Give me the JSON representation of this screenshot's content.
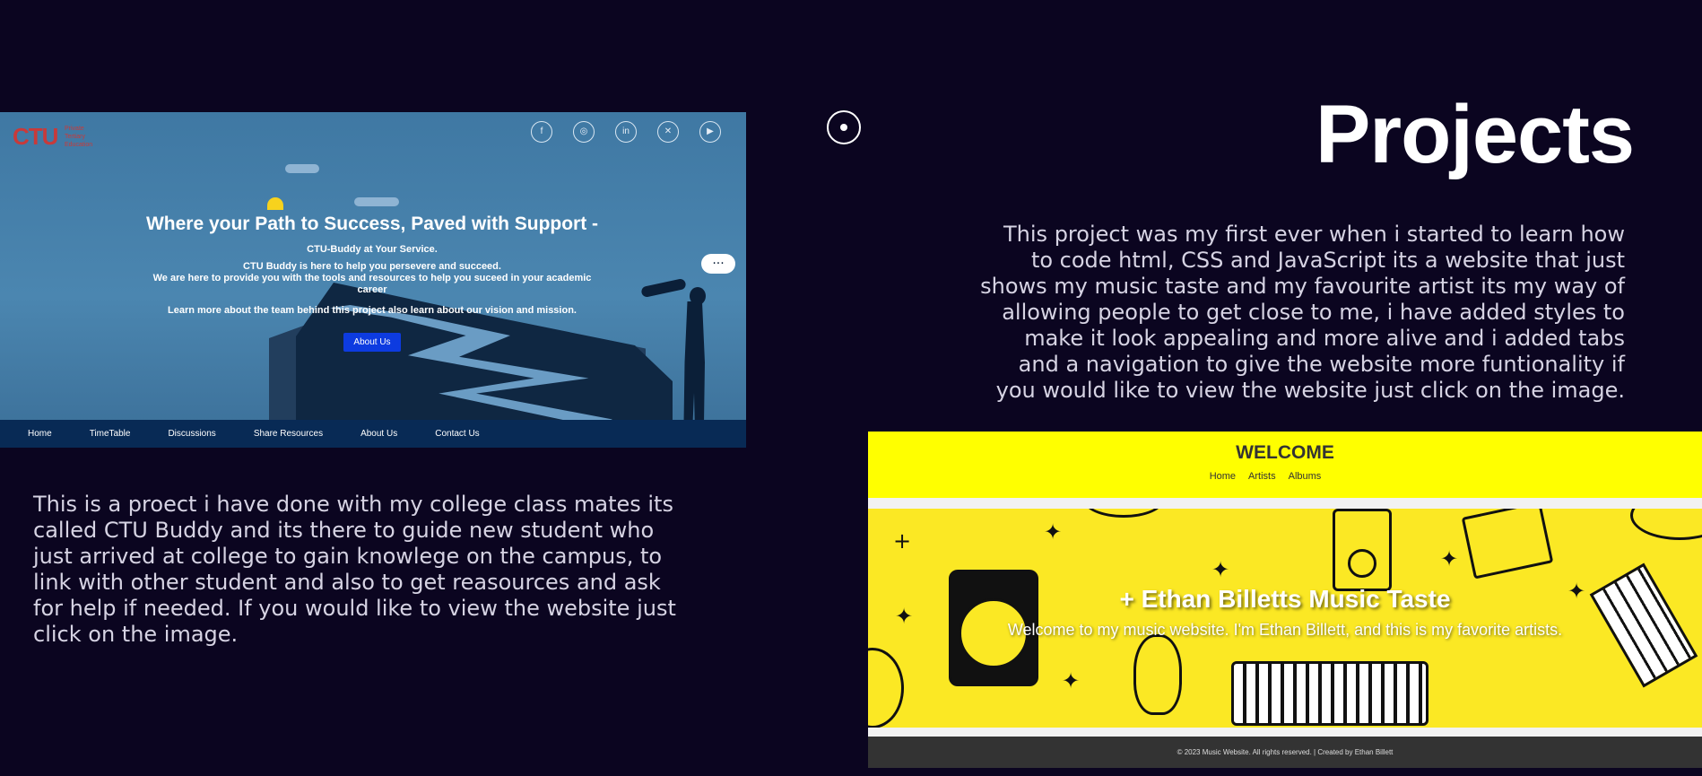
{
  "page": {
    "heading": "Projects",
    "project_music_description": "This project was my first ever when i started to learn how to code html, CSS and JavaScript its a website that just shows my music taste and my favourite artist its my way of allowing people to get close to me, i have added styles to make it look appealing and more alive and i added tabs and a navigation to give the website more funtionality if you would like to view the website just click on the image.",
    "project_ctu_description": "This is a proect i have done with my college class mates its called CTU Buddy and its there to guide new student who just arrived at college to gain knowlege on the campus, to link with other student and also to get reasources and ask for help if needed. If you would like to view the website just click on the image."
  },
  "ctu_site": {
    "logo_text": "CTU",
    "logo_sub": [
      "Private",
      "Tertiary",
      "Education"
    ],
    "socials": [
      {
        "icon": "facebook-icon",
        "glyph": "f"
      },
      {
        "icon": "instagram-icon",
        "glyph": "◎"
      },
      {
        "icon": "linkedin-icon",
        "glyph": "in"
      },
      {
        "icon": "twitter-icon",
        "glyph": "🐦"
      },
      {
        "icon": "youtube-icon",
        "glyph": "▶"
      }
    ],
    "hero_title": "Where your Path to Success, Paved with Support -",
    "hero_tag": "CTU-Buddy at Your Service.",
    "hero_line1": "CTU Buddy is here to help you persevere and succeed.",
    "hero_line2": "We are here to provide you with the tools and resources to help you suceed in your academic career",
    "hero_line3": "Learn more about the team behind this project also learn about our vision and mission.",
    "button": "About Us",
    "bubble": "...",
    "nav": [
      "Home",
      "TimeTable",
      "Discussions",
      "Share Resources",
      "About Us",
      "Contact Us"
    ]
  },
  "music_site": {
    "welcome": "WELCOME",
    "nav": [
      "Home",
      "Artists",
      "Albums"
    ],
    "banner_title": "Ethan Billetts Music Taste",
    "banner_subtitle": "Welcome to my music website. I'm Ethan Billett, and this is my favorite artists.",
    "footer": "© 2023 Music Website. All rights reserved. | Created by Ethan Billett"
  }
}
